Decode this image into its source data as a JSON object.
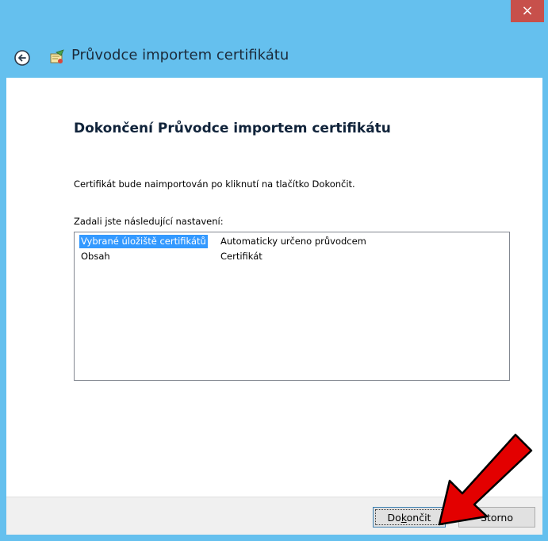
{
  "window": {
    "close_glyph": "×",
    "title": "Průvodce importem certifikátu"
  },
  "page": {
    "heading": "Dokončení Průvodce importem certifikátu",
    "info": "Certifikát bude naimportován po kliknutí na tlačítko Dokončit.",
    "settings_label": "Zadali jste následující nastavení:",
    "settings": [
      {
        "name": "Vybrané úložiště certifikátů",
        "value": "Automaticky určeno průvodcem",
        "selected": true
      },
      {
        "name": "Obsah",
        "value": "Certifikát",
        "selected": false
      }
    ]
  },
  "buttons": {
    "finish_pre": "Do",
    "finish_key": "k",
    "finish_post": "ončit",
    "cancel": "Storno"
  },
  "icons": {
    "back": "back-arrow-icon",
    "wizard": "certificate-wizard-icon",
    "close": "close-icon"
  },
  "colors": {
    "titlebar": "#65c0ee",
    "close": "#c7504b",
    "selection": "#3399ff",
    "annotation_arrow": "#e30000"
  }
}
